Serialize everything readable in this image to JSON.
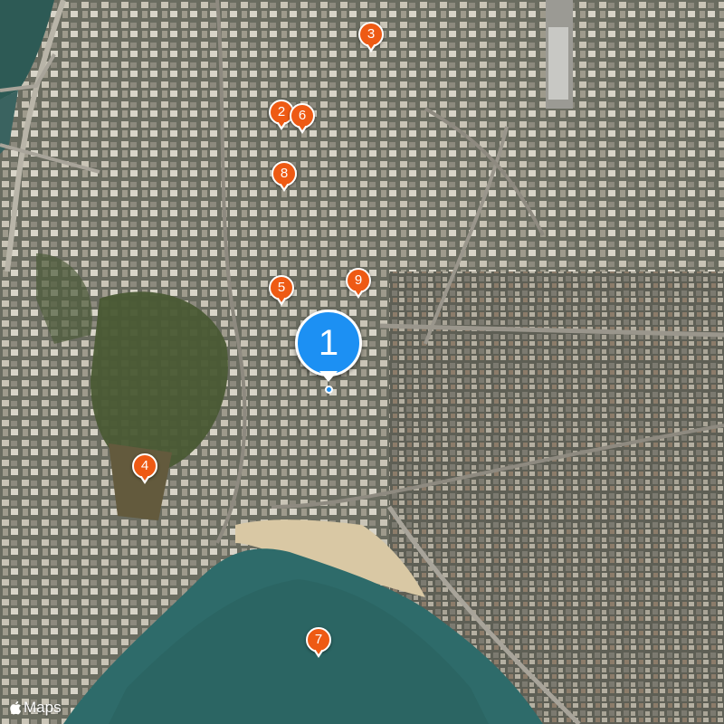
{
  "map": {
    "type": "satellite",
    "attribution_label": "Maps",
    "attribution_icon": "apple-logo-icon",
    "colors": {
      "pin": "#ee5a14",
      "primary_pin": "#1c90f3",
      "water": "#2e6b6a",
      "beach": "#d9c8a4"
    }
  },
  "primary_marker": {
    "label": "1",
    "icon": "current-location-icon"
  },
  "markers": [
    {
      "id": "2",
      "label": "2"
    },
    {
      "id": "3",
      "label": "3"
    },
    {
      "id": "4",
      "label": "4"
    },
    {
      "id": "5",
      "label": "5"
    },
    {
      "id": "6",
      "label": "6"
    },
    {
      "id": "7",
      "label": "7"
    },
    {
      "id": "8",
      "label": "8"
    },
    {
      "id": "9",
      "label": "9"
    }
  ]
}
